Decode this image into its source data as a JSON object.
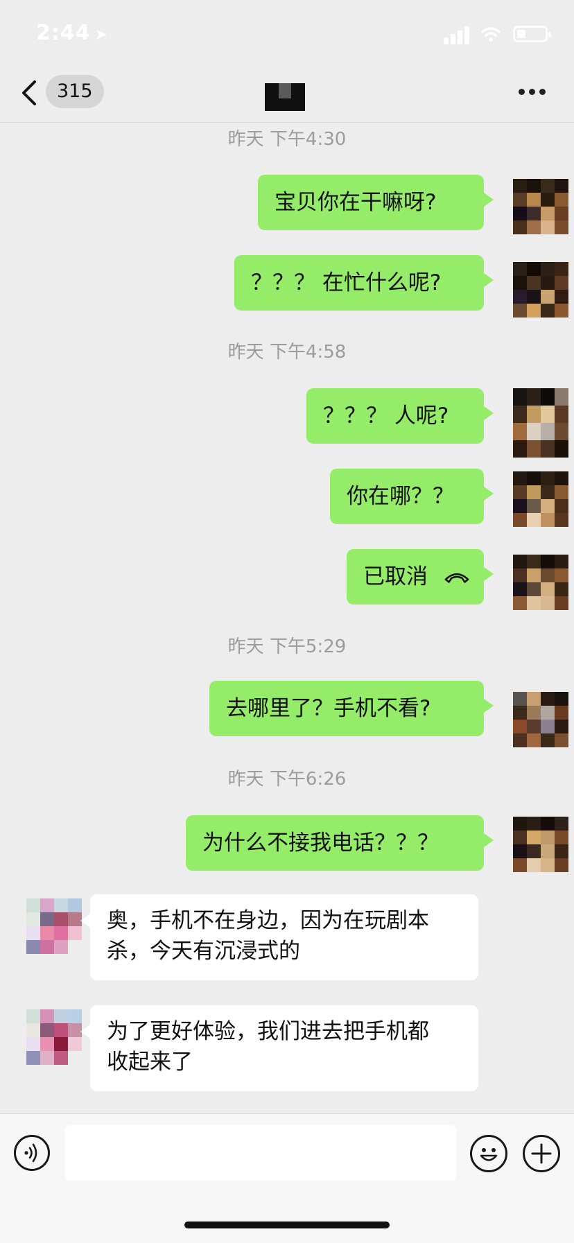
{
  "status_bar": {
    "time": "2:44"
  },
  "header": {
    "back_count": "315"
  },
  "timestamps": [
    "昨天 下午4:30",
    "昨天 下午4:58",
    "昨天 下午5:29",
    "昨天 下午6:26"
  ],
  "messages": [
    {
      "text": "宝贝你在干嘛呀?"
    },
    {
      "text": "？？？ 在忙什么呢?"
    },
    {
      "text": "？？？ 人呢?"
    },
    {
      "text": "你在哪？？"
    },
    {
      "text": "已取消",
      "icon": "phone-hangup-icon"
    },
    {
      "text": "去哪里了？手机不看?"
    },
    {
      "text": "为什么不接我电话？？？"
    },
    {
      "text": "奥，手机不在身边，因为在玩剧本\n杀，今天有沉浸式的"
    },
    {
      "text": "为了更好体验，我们进去把手机都\n收起来了"
    }
  ],
  "colors": {
    "outgoing_bubble": "#95ec69",
    "incoming_bubble": "#ffffff",
    "background": "#ededed"
  }
}
